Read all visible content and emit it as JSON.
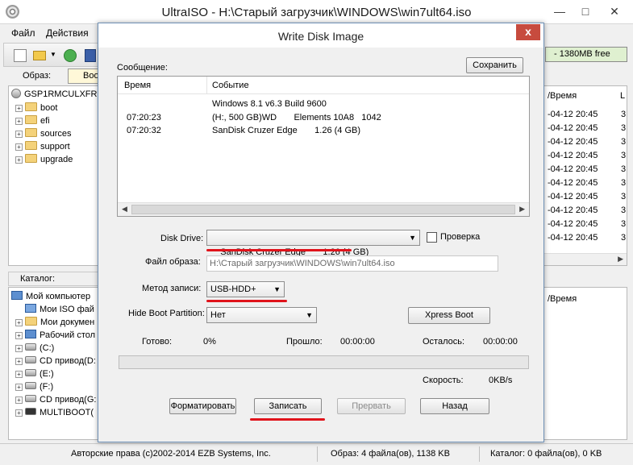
{
  "main": {
    "title": "UltraISO - H:\\Старый загрузчик\\WINDOWS\\win7ult64.iso",
    "menu": [
      "Файл",
      "Действия"
    ],
    "free_space": "- 1380MB free",
    "obraz_label": "Образ:",
    "obraz_value": "Boo",
    "tree": {
      "root": "GSP1RMCULXFR",
      "items": [
        "boot",
        "efi",
        "sources",
        "support",
        "upgrade"
      ]
    },
    "catalog_label": "Каталог:",
    "catalog": [
      "Мой компьютер",
      "Мои ISO фай",
      "Мои докумен",
      "Рабочий стол",
      "(C:)",
      "CD привод(D:",
      "(E:)",
      "(F:)",
      "CD привод(G:",
      "MULTIBOOT("
    ],
    "right_header": "/Время",
    "right_header2": "/Время",
    "right_col2": "L",
    "right_rows": [
      "-04-12 20:45",
      "-04-12 20:45",
      "-04-12 20:45",
      "-04-12 20:45",
      "-04-12 20:45",
      "-04-12 20:45",
      "-04-12 20:45",
      "-04-12 20:45",
      "-04-12 20:45",
      "-04-12 20:45"
    ],
    "right_rows_col2": [
      "3",
      "3",
      "3",
      "3",
      "3",
      "3",
      "3",
      "3",
      "3",
      "3"
    ],
    "status": {
      "copyright": "Авторские права (c)2002-2014 EZB Systems, Inc.",
      "image": "Образ: 4 файла(ов), 1138 KB",
      "catalog": "Каталог: 0 файла(ов), 0 KB"
    }
  },
  "dialog": {
    "title": "Write Disk Image",
    "close_glyph": "x",
    "message_label": "Сообщение:",
    "save_button": "Сохранить",
    "log_columns": [
      "Время",
      "Событие"
    ],
    "log_rows": [
      {
        "time": "",
        "event": "Windows 8.1 v6.3 Build 9600"
      },
      {
        "time": "07:20:23",
        "event": "(H:, 500 GB)WD       Elements 10A8   1042"
      },
      {
        "time": "07:20:32",
        "event": "SanDisk Cruzer Edge       1.26 (4 GB)"
      }
    ],
    "disk_drive_label": "Disk Drive:",
    "disk_drive_value": "SanDisk Cruzer Edge       1.26 (4 GB)",
    "verify_label": "Проверка",
    "image_file_label": "Файл образа:",
    "image_file_value": "H:\\Старый загрузчик\\WINDOWS\\win7ult64.iso",
    "write_method_label": "Метод записи:",
    "write_method_value": "USB-HDD+",
    "hide_boot_label": "Hide Boot Partition:",
    "hide_boot_value": "Нет",
    "xpress_boot_button": "Xpress Boot",
    "done_label": "Готово:",
    "done_value": "0%",
    "elapsed_label": "Прошло:",
    "elapsed_value": "00:00:00",
    "remaining_label": "Осталось:",
    "remaining_value": "00:00:00",
    "progress_fraction": 0,
    "speed_label": "Скорость:",
    "speed_value": "0KB/s",
    "format_button": "Форматировать",
    "write_button": "Записать",
    "abort_button": "Прервать",
    "back_button": "Назад"
  },
  "colors": {
    "highlight_underline": "#e0131b",
    "close_button": "#c74b3e",
    "free_bar": "#dff0d0"
  }
}
